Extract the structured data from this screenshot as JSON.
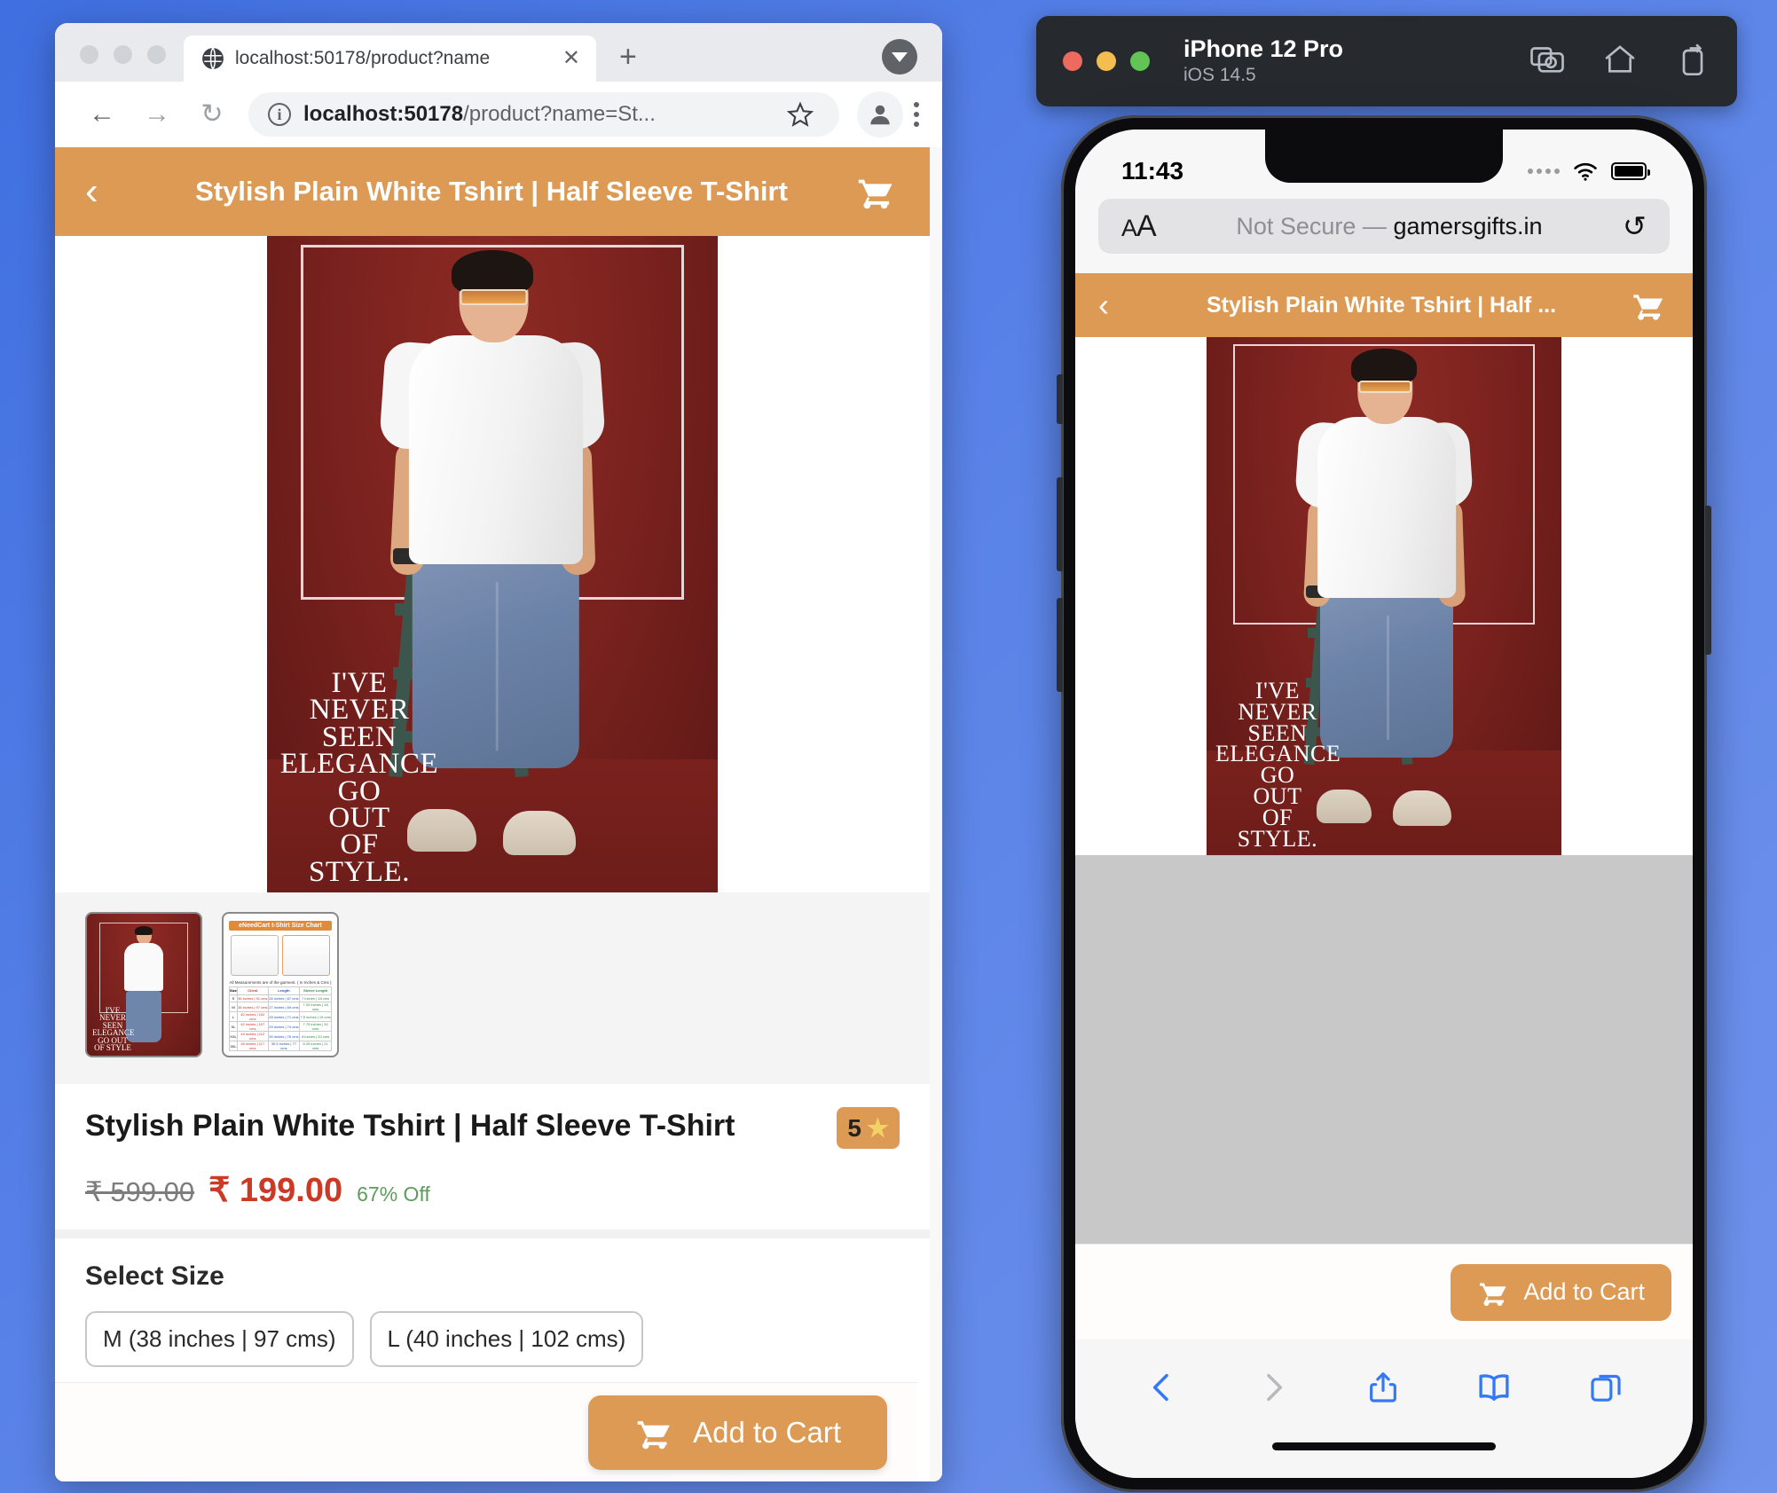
{
  "desktop_browser": {
    "tab": {
      "title": "localhost:50178/product?name",
      "close_label": "✕",
      "favicon": "globe-icon"
    },
    "new_tab_label": "+",
    "toolbar": {
      "back": "←",
      "forward": "→",
      "reload": "↻",
      "url_display": "localhost:50178",
      "url_path": "/product?name=St...",
      "bookmark": "star-icon",
      "profile": "avatar-icon",
      "menu": "three-dots-icon"
    }
  },
  "page": {
    "header": {
      "back": "‹",
      "title": "Stylish Plain White Tshirt | Half Sleeve T-Shirt",
      "cart": "cart-icon"
    },
    "hero_quote": [
      "I'VE",
      "NEVER",
      "SEEN",
      "ELEGANCE",
      "GO",
      "OUT",
      "OF",
      "STYLE."
    ],
    "thumbnails": [
      {
        "name": "product-photo-thumbnail",
        "alt": "Model wearing white t-shirt"
      },
      {
        "name": "size-chart-thumbnail",
        "alt": "eNeedCart t-Shirt Size Chart"
      }
    ],
    "size_chart": {
      "title": "eNeedCart t-Shirt Size Chart",
      "note": "All Measurements are of the garment. ( In Inches & Cms )",
      "headers": [
        "Size",
        "Chest",
        "Length",
        "Sleeve Length"
      ],
      "rows": [
        [
          "S",
          "36 inches | 91 cms",
          "26 inches | 67 cms",
          "7 inches | 18 cms"
        ],
        [
          "M",
          "38 inches | 97 cms",
          "27 inches | 69 cms",
          "7.25 inches | 18 cms"
        ],
        [
          "L",
          "40 inches | 102 cms",
          "28 inches | 71 cms",
          "7.5 inches | 19 cms"
        ],
        [
          "XL",
          "42 inches | 107 cms",
          "29 inches | 74 cms",
          "7.75 inches | 20 cms"
        ],
        [
          "XXL",
          "44 inches | 112 cms",
          "30 inches | 76 cms",
          "8 inches | 20 cms"
        ],
        [
          "3XL",
          "46 inches | 117 cms",
          "30.5 inches | 77 cms",
          "8.25 inches | 21 cms"
        ]
      ]
    },
    "product": {
      "title": "Stylish Plain White Tshirt | Half Sleeve T-Shirt",
      "rating": "5",
      "rating_star": "★",
      "price_old": "₹ 599.00",
      "price_new": "₹ 199.00",
      "discount": "67% Off"
    },
    "size_section": {
      "label": "Select Size",
      "options": [
        "M (38 inches | 97 cms)",
        "L (40 inches | 102 cms)"
      ]
    },
    "cta": {
      "label": "Add to Cart",
      "icon": "cart-icon"
    }
  },
  "simulator": {
    "device_name": "iPhone 12 Pro",
    "os_version": "iOS 14.5",
    "actions": [
      "screenshot-icon",
      "home-icon",
      "rotate-icon"
    ],
    "status_bar": {
      "time": "11:43",
      "signal": "signal-dots",
      "wifi": "wifi-icon",
      "battery": "battery-icon"
    },
    "safari": {
      "text_size_label_small": "A",
      "text_size_label_large": "A",
      "not_secure": "Not Secure — ",
      "domain": "gamersgifts.in",
      "reload": "↻"
    },
    "mobile_page": {
      "header": {
        "back": "‹",
        "title": "Stylish Plain White Tshirt | Half ...",
        "cart": "cart-icon"
      },
      "cta": {
        "label": "Add to Cart",
        "icon": "cart-icon"
      }
    },
    "toolbar": [
      "back-chevron-icon",
      "forward-chevron-icon",
      "share-icon",
      "bookmarks-icon",
      "tabs-icon"
    ]
  },
  "colors": {
    "brand_orange": "#dd9a54",
    "price_red": "#cc3a26",
    "discount_green": "#5e9c5e",
    "desktop_bg_blue": "#4a76e3",
    "ios_blue": "#3478f6"
  }
}
